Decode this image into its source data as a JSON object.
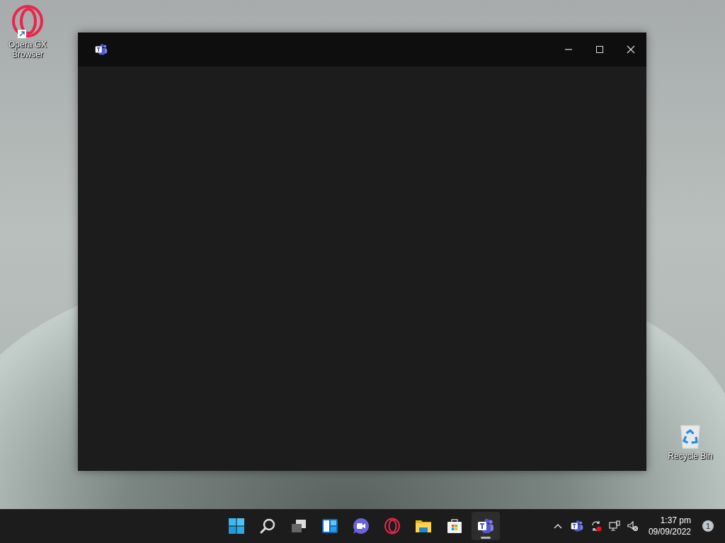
{
  "desktop_icons": [
    {
      "kind": "opera",
      "label": "Opera GX Browser",
      "shortcut": true
    },
    {
      "kind": "recycle",
      "label": "Recycle Bin",
      "shortcut": false
    }
  ],
  "window": {
    "kind": "teams"
  },
  "taskbar": {
    "apps": [
      {
        "kind": "start",
        "selected": false
      },
      {
        "kind": "search",
        "selected": false
      },
      {
        "kind": "taskview",
        "selected": false
      },
      {
        "kind": "widgets",
        "selected": false
      },
      {
        "kind": "chat",
        "selected": false
      },
      {
        "kind": "opera",
        "selected": false
      },
      {
        "kind": "explorer",
        "selected": false
      },
      {
        "kind": "store",
        "selected": false
      },
      {
        "kind": "teams",
        "selected": true
      }
    ],
    "tray": {
      "icons": [
        {
          "kind": "chevron"
        },
        {
          "kind": "teams"
        },
        {
          "kind": "sync"
        },
        {
          "kind": "network"
        },
        {
          "kind": "muted"
        }
      ],
      "time": "1:37 pm",
      "date": "09/09/2022",
      "notifications": "1"
    }
  }
}
